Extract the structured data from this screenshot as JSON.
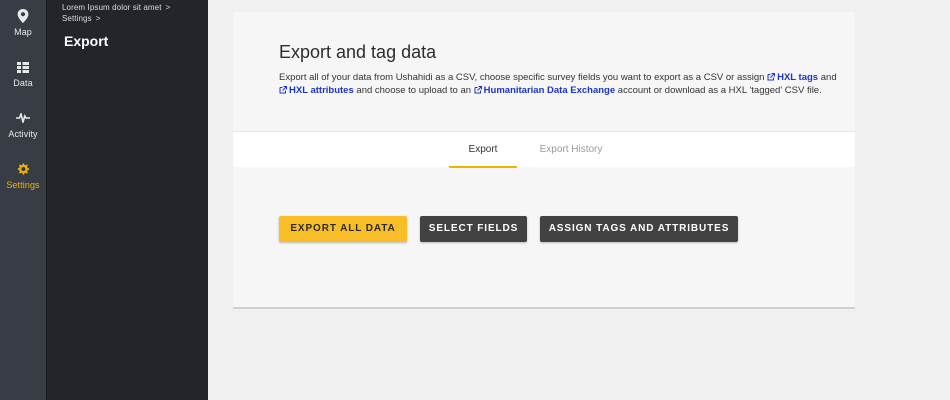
{
  "colors": {
    "rail_bg": "#383d45",
    "panel_bg": "#22262b",
    "accent": "#f0b400",
    "link": "#1a35c9",
    "dark_button": "#424242"
  },
  "rail": {
    "items": [
      {
        "label": "Map",
        "icon": "map-pin-icon"
      },
      {
        "label": "Data",
        "icon": "data-list-icon"
      },
      {
        "label": "Activity",
        "icon": "activity-pulse-icon"
      },
      {
        "label": "Settings",
        "icon": "gear-icon"
      }
    ]
  },
  "panel": {
    "breadcrumbs": [
      {
        "label": "Lorem Ipsum dolor sit amet",
        "sep": ">"
      },
      {
        "label": "Settings",
        "sep": ">"
      }
    ],
    "title": "Export"
  },
  "card": {
    "title": "Export and tag data",
    "description": {
      "part1": "Export all of your data from Ushahidi as a CSV, choose specific survey fields you want to export as a CSV or assign ",
      "link1": "HXL tags",
      "part2": " and ",
      "link2": "HXL attributes",
      "part3": " and choose to upload to an ",
      "link3": "Humanitarian Data Exchange",
      "part4": " account or download as a HXL 'tagged' CSV file."
    },
    "tabs": [
      {
        "label": "Export",
        "active": true
      },
      {
        "label": "Export History",
        "active": false
      }
    ],
    "buttons": {
      "export_all": "EXPORT ALL DATA",
      "select_fields": "SELECT FIELDS",
      "assign_tags": "ASSIGN TAGS AND ATTRIBUTES"
    }
  }
}
